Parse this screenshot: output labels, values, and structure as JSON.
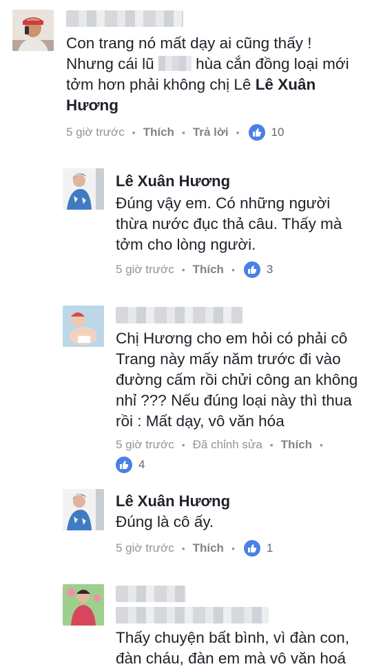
{
  "comments": [
    {
      "text_prefix": "Con trang nó mất dạy ai cũng thấy ! Nhưng cái lũ",
      "text_middle": "hùa cắn đồng loại mới tởm hơn phải không chị Lê",
      "mention": "Lê Xuân Hương",
      "time": "5 giờ trước",
      "like": "Thích",
      "reply": "Trả lời",
      "reactions": "10"
    },
    {
      "name": "Lê Xuân Hương",
      "text": "Đúng vậy em. Có những người thừa nước đục thả câu. Thấy mà tởm cho lòng người.",
      "time": "5 giờ trước",
      "like": "Thích",
      "reactions": "3"
    },
    {
      "text": "Chị Hương cho em hỏi có phải cô Trang này mấy năm trước đi vào đường cấm rồi chửi công an không nhỉ ??? Nếu đúng loại này thì thua rồi : Mất dạy, vô văn hóa",
      "time": "5 giờ trước",
      "edited": "Đã chỉnh sửa",
      "like": "Thích",
      "reactions": "4"
    },
    {
      "name": "Lê Xuân Hương",
      "text": "Đúng là cô ấy.",
      "time": "5 giờ trước",
      "like": "Thích",
      "reactions": "1"
    },
    {
      "text": "Thấy chuyện bất bình, vì đàn con, đàn cháu, đàn em mà vô văn hoá"
    }
  ],
  "colors": {
    "like_blue": "#4a80e6",
    "meta_gray": "#90949c"
  },
  "icons": {
    "like": "thumbs-up-icon"
  }
}
